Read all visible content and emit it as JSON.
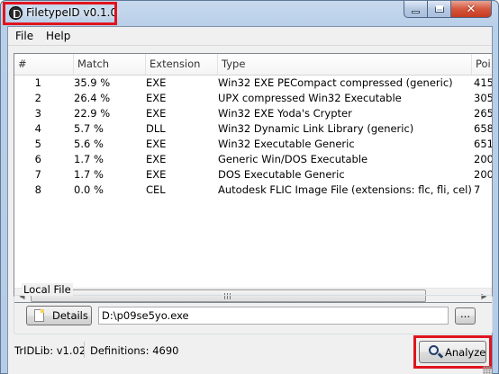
{
  "window": {
    "title": "FiletypeID v0.1.0",
    "accent_highlight": "#e0141e",
    "close_glyph": "✕"
  },
  "menu": [
    "File",
    "Help"
  ],
  "list": {
    "columns": [
      "#",
      "Match",
      "Extension",
      "Type",
      "Poi"
    ],
    "rows": [
      {
        "num": "1",
        "match": "35.9 %",
        "ext": "EXE",
        "type": "Win32 EXE PECompact compressed (generic)",
        "points": "415"
      },
      {
        "num": "2",
        "match": "26.4 %",
        "ext": "EXE",
        "type": "UPX compressed Win32 Executable",
        "points": "305"
      },
      {
        "num": "3",
        "match": "22.9 %",
        "ext": "EXE",
        "type": "Win32 EXE Yoda's Crypter",
        "points": "265"
      },
      {
        "num": "4",
        "match": "5.7 %",
        "ext": "DLL",
        "type": "Win32 Dynamic Link Library (generic)",
        "points": "658"
      },
      {
        "num": "5",
        "match": "5.6 %",
        "ext": "EXE",
        "type": "Win32 Executable Generic",
        "points": "651"
      },
      {
        "num": "6",
        "match": "1.7 %",
        "ext": "EXE",
        "type": "Generic Win/DOS Executable",
        "points": "200"
      },
      {
        "num": "7",
        "match": "1.7 %",
        "ext": "EXE",
        "type": "DOS Executable Generic",
        "points": "200"
      },
      {
        "num": "8",
        "match": "0.0 %",
        "ext": "CEL",
        "type": "Autodesk FLIC Image File (extensions: flc, fli, cel)",
        "points": "7"
      }
    ]
  },
  "local_file": {
    "group_label": "Local File",
    "details_label": "Details",
    "path": "D:\\p09se5yo.exe",
    "browse_label": "..."
  },
  "status": {
    "tridlib": "TrIDLib:  v1.02",
    "definitions": "Definitions:  4690"
  },
  "analyze_label": "Analyze"
}
